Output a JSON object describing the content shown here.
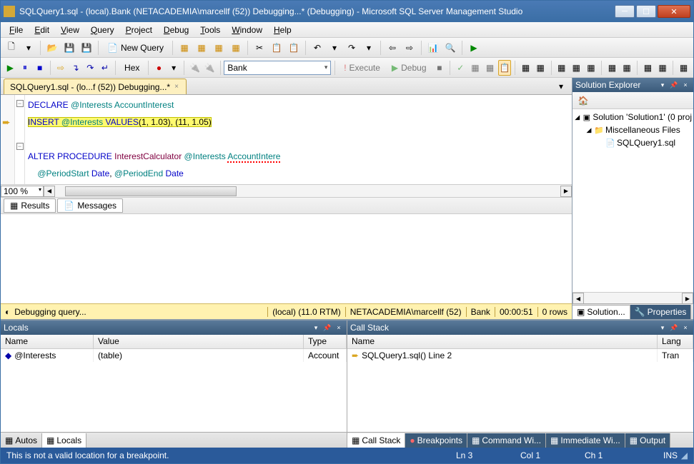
{
  "titlebar": {
    "text": "SQLQuery1.sql - (local).Bank (NETACADEMIA\\marcellf (52)) Debugging...* (Debugging) - Microsoft SQL Server Management Studio"
  },
  "menu": {
    "file": "File",
    "edit": "Edit",
    "view": "View",
    "query": "Query",
    "project": "Project",
    "debug": "Debug",
    "tools": "Tools",
    "window": "Window",
    "help": "Help"
  },
  "toolbar1": {
    "new_query": "New Query",
    "db_combo": "Bank",
    "execute": "Execute",
    "debug": "Debug",
    "hex": "Hex"
  },
  "doc_tab": {
    "label": "SQLQuery1.sql - (lo...f (52)) Debugging...*"
  },
  "code": {
    "line1_kw": "DECLARE ",
    "line1_var": "@Interests ",
    "line1_type": "AccountInterest",
    "line2_kw": "INSERT ",
    "line2_var": "@Interests ",
    "line2_kw2": "VALUES",
    "line2_vals": "(1, 1.03), (11, 1.05)",
    "line4_kw": "ALTER PROCEDURE ",
    "line4_fn": "InterestCalculator ",
    "line4_var": "@Interests ",
    "line4_type": "AccountIntere",
    "line5_a": "    @PeriodStart ",
    "line5_date1": "Date",
    "line5_comma": ", ",
    "line5_b": "@PeriodEnd ",
    "line5_date2": "Date"
  },
  "zoom": "100 %",
  "result_tabs": {
    "results": "Results",
    "messages": "Messages"
  },
  "debug_status": {
    "left": "Debugging query...",
    "server": "(local) (11.0 RTM)",
    "user": "NETACADEMIA\\marcellf (52)",
    "db": "Bank",
    "time": "00:00:51",
    "rows": "0 rows"
  },
  "solution": {
    "title": "Solution Explorer",
    "root": "Solution 'Solution1' (0 proj",
    "folder": "Miscellaneous Files",
    "file": "SQLQuery1.sql",
    "tab_sol": "Solution...",
    "tab_prop": "Properties"
  },
  "locals": {
    "title": "Locals",
    "col_name": "Name",
    "col_value": "Value",
    "col_type": "Type",
    "row1_name": "@Interests",
    "row1_value": "(table)",
    "row1_type": "Account"
  },
  "callstack": {
    "title": "Call Stack",
    "col_name": "Name",
    "col_lang": "Lang",
    "row1_name": "SQLQuery1.sql() Line 2",
    "row1_lang": "Tran"
  },
  "lower_tabs_left": {
    "autos": "Autos",
    "locals": "Locals"
  },
  "lower_tabs_right": {
    "callstack": "Call Stack",
    "breakpoints": "Breakpoints",
    "command": "Command Wi...",
    "immediate": "Immediate Wi...",
    "output": "Output"
  },
  "statusbar": {
    "msg": "This is not a valid location for a breakpoint.",
    "ln": "Ln 3",
    "col": "Col 1",
    "ch": "Ch 1",
    "ins": "INS"
  }
}
